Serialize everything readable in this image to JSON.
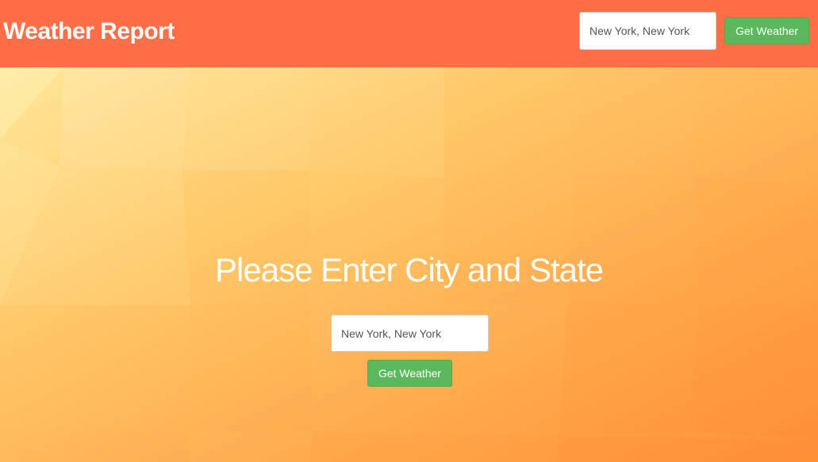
{
  "navbar": {
    "brand": "Weather Report",
    "search_placeholder": "New York, New York",
    "button_label": "Get Weather",
    "background_color": "#ff6e47"
  },
  "hero": {
    "title": "Please Enter City and State",
    "search_placeholder": "New York, New York",
    "button_label": "Get Weather",
    "background_colors": [
      "#ffe79a",
      "#ffc865",
      "#ffa548",
      "#ff9239"
    ]
  },
  "colors": {
    "button_green": "#5cb85c",
    "text_white": "#ffffff"
  }
}
